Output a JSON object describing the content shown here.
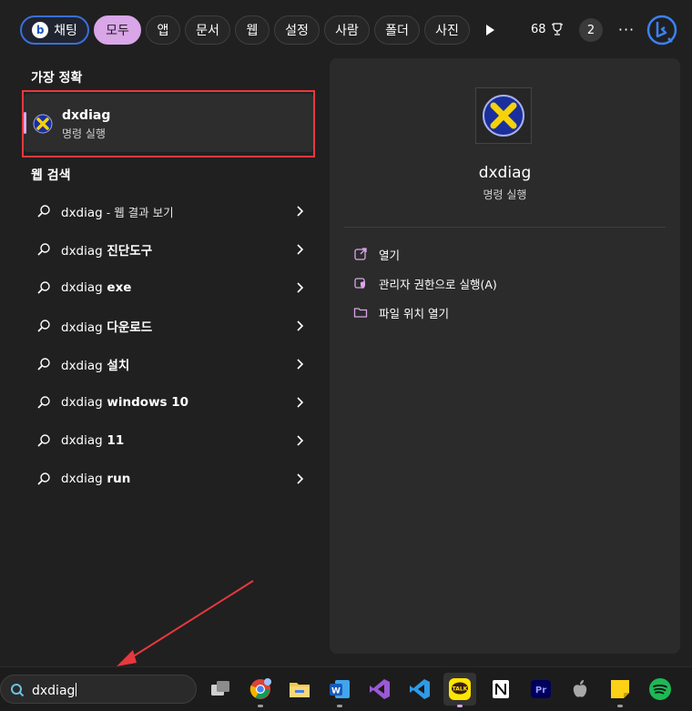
{
  "topbar": {
    "chips": [
      {
        "label": "채팅"
      },
      {
        "label": "모두"
      },
      {
        "label": "앱"
      },
      {
        "label": "문서"
      },
      {
        "label": "웹"
      },
      {
        "label": "설정"
      },
      {
        "label": "사람"
      },
      {
        "label": "폴더"
      },
      {
        "label": "사진"
      }
    ],
    "points": "68",
    "notification_count": "2",
    "more_label": "···"
  },
  "results": {
    "best_match_heading": "가장 정확",
    "best_match": {
      "title": "dxdiag",
      "subtitle": "명령 실행"
    },
    "web_heading": "웹 검색",
    "web_items": [
      {
        "query": "dxdiag",
        "suffix": " - 웹 결과 보기"
      },
      {
        "query": "dxdiag",
        "suffix": " 진단도구"
      },
      {
        "query": "dxdiag",
        "suffix": " exe"
      },
      {
        "query": "dxdiag",
        "suffix": " 다운로드"
      },
      {
        "query": "dxdiag",
        "suffix": " 설치"
      },
      {
        "query": "dxdiag",
        "suffix": " windows 10"
      },
      {
        "query": "dxdiag",
        "suffix": " 11"
      },
      {
        "query": "dxdiag",
        "suffix": " run"
      }
    ]
  },
  "detail": {
    "title": "dxdiag",
    "subtitle": "명령 실행",
    "actions": [
      {
        "label": "열기",
        "icon": "open-icon"
      },
      {
        "label": "관리자 권한으로 실행(A)",
        "icon": "shield-icon"
      },
      {
        "label": "파일 위치 열기",
        "icon": "folder-icon"
      }
    ]
  },
  "taskbar": {
    "search_value": "dxdiag",
    "apps": [
      "task-view",
      "chrome",
      "file-explorer",
      "word",
      "visual-studio",
      "vscode",
      "kakaotalk",
      "notion",
      "premiere-pro",
      "apple",
      "sticky-notes",
      "spotify"
    ]
  },
  "colors": {
    "accent": "#d9a6e8",
    "highlight_box": "#e8383d",
    "background": "#202020",
    "pane": "#2b2b2b"
  }
}
